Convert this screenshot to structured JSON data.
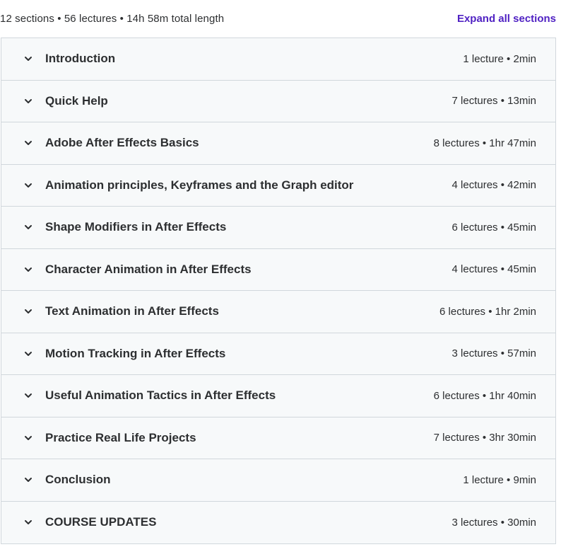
{
  "summary": {
    "text": "12 sections • 56 lectures • 14h 58m total length",
    "expand_label": "Expand all sections"
  },
  "colors": {
    "accent": "#5022c3",
    "row_bg": "#f7f9fa",
    "border": "#d1d7dc",
    "text": "#2d2f31"
  },
  "sections": [
    {
      "title": "Introduction",
      "meta": "1 lecture • 2min",
      "icon": "chevron-down-icon"
    },
    {
      "title": "Quick Help",
      "meta": "7 lectures • 13min",
      "icon": "chevron-down-icon"
    },
    {
      "title": "Adobe After Effects Basics",
      "meta": "8 lectures • 1hr 47min",
      "icon": "chevron-down-icon"
    },
    {
      "title": "Animation principles, Keyframes and the Graph editor",
      "meta": "4 lectures • 42min",
      "icon": "chevron-down-icon"
    },
    {
      "title": "Shape Modifiers in After Effects",
      "meta": "6 lectures • 45min",
      "icon": "chevron-down-icon"
    },
    {
      "title": "Character Animation in After Effects",
      "meta": "4 lectures • 45min",
      "icon": "chevron-down-icon"
    },
    {
      "title": "Text Animation in After Effects",
      "meta": "6 lectures • 1hr 2min",
      "icon": "chevron-down-icon"
    },
    {
      "title": "Motion Tracking in After Effects",
      "meta": "3 lectures • 57min",
      "icon": "chevron-down-icon"
    },
    {
      "title": "Useful Animation Tactics in After Effects",
      "meta": "6 lectures • 1hr 40min",
      "icon": "chevron-down-icon"
    },
    {
      "title": "Practice Real Life Projects",
      "meta": "7 lectures • 3hr 30min",
      "icon": "chevron-down-icon"
    },
    {
      "title": "Conclusion",
      "meta": "1 lecture • 9min",
      "icon": "chevron-down-icon"
    },
    {
      "title": "COURSE UPDATES",
      "meta": "3 lectures • 30min",
      "icon": "chevron-down-icon"
    }
  ]
}
